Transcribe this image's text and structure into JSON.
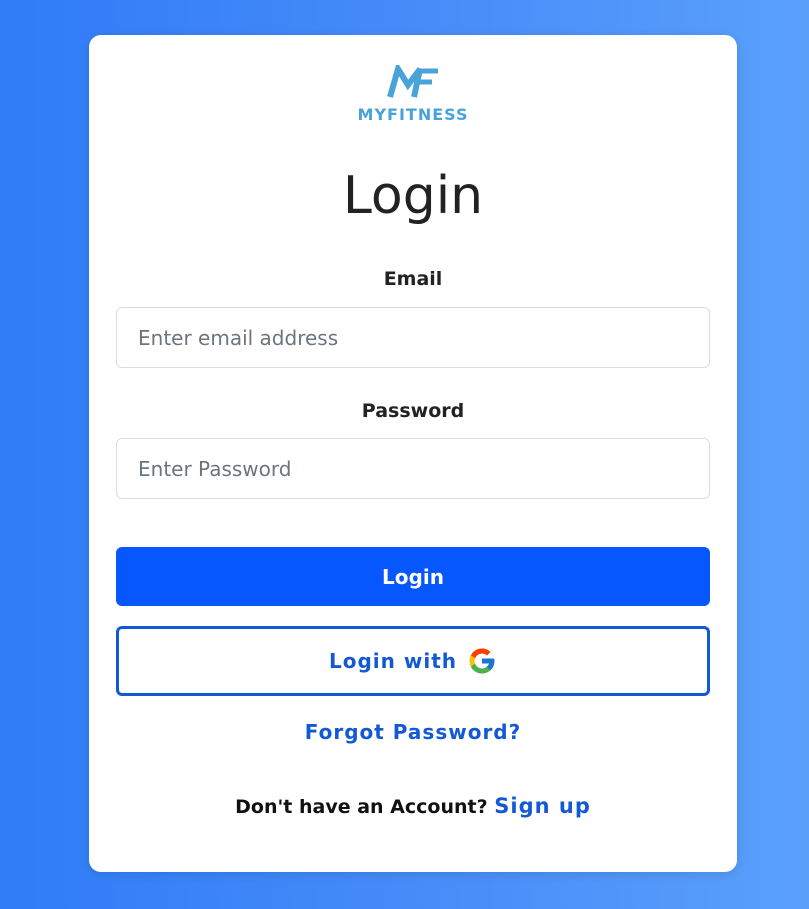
{
  "brand": {
    "logo_text": "MYFITNESS",
    "color": "#4aa3d8"
  },
  "page": {
    "title": "Login"
  },
  "form": {
    "email_label": "Email",
    "email_placeholder": "Enter email address",
    "email_value": "",
    "password_label": "Password",
    "password_placeholder": "Enter Password",
    "password_value": ""
  },
  "actions": {
    "login_label": "Login",
    "google_login_label": "Login with",
    "google_icon": "google-g-icon",
    "forgot_label": "Forgot Password?",
    "signup_prompt": "Don't have an Account?",
    "signup_label": "Sign up"
  },
  "colors": {
    "primary": "#0657fd",
    "link": "#1459d4"
  }
}
